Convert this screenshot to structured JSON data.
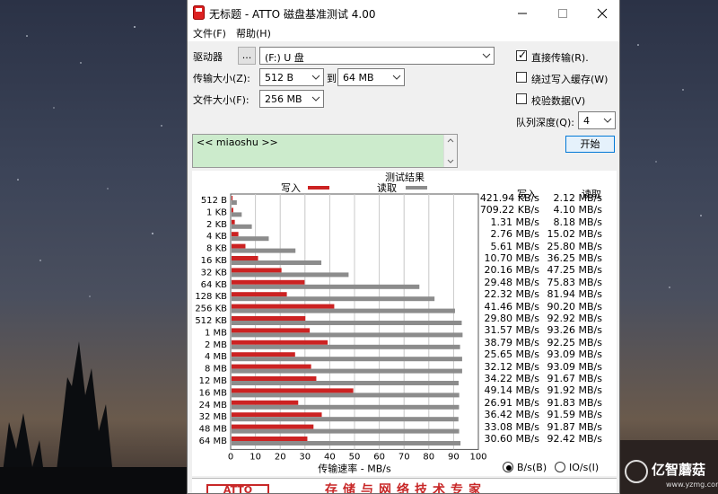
{
  "window": {
    "title": "无标题 - ATTO 磁盘基准测试 4.00"
  },
  "menu": {
    "file": "文件(F)",
    "help": "帮助(H)"
  },
  "controls": {
    "drive_label": "驱动器",
    "browse_label": "...",
    "drive_value": "(F:) U 盘",
    "transfer_size_label": "传输大小(Z):",
    "transfer_from": "512 B",
    "to_label": "到",
    "transfer_to": "64 MB",
    "file_size_label": "文件大小(F):",
    "file_size": "256 MB",
    "direct_io_label": "直接传输(R).",
    "direct_io_checked": true,
    "bypass_cache_label": "绕过写入缓存(W)",
    "bypass_cache_checked": false,
    "verify_label": "校验数据(V)",
    "verify_checked": false,
    "queue_depth_label": "队列深度(Q):",
    "queue_depth": "4",
    "start_label": "开始",
    "description": "<< miaoshu >>"
  },
  "results": {
    "title": "测试结果",
    "legend_write": "写入",
    "legend_read": "读取",
    "col_write": "写入",
    "col_read": "读取",
    "write_values": [
      "421.94 KB/s",
      "709.22 KB/s",
      "1.31 MB/s",
      "2.76 MB/s",
      "5.61 MB/s",
      "10.70 MB/s",
      "20.16 MB/s",
      "29.48 MB/s",
      "22.32 MB/s",
      "41.46 MB/s",
      "29.80 MB/s",
      "31.57 MB/s",
      "38.79 MB/s",
      "25.65 MB/s",
      "32.12 MB/s",
      "34.22 MB/s",
      "49.14 MB/s",
      "26.91 MB/s",
      "36.42 MB/s",
      "33.08 MB/s",
      "30.60 MB/s"
    ],
    "read_values": [
      "2.12 MB/s",
      "4.10 MB/s",
      "8.18 MB/s",
      "15.02 MB/s",
      "25.80 MB/s",
      "36.25 MB/s",
      "47.25 MB/s",
      "75.83 MB/s",
      "81.94 MB/s",
      "90.20 MB/s",
      "92.92 MB/s",
      "93.26 MB/s",
      "92.25 MB/s",
      "93.09 MB/s",
      "93.09 MB/s",
      "91.67 MB/s",
      "91.92 MB/s",
      "91.83 MB/s",
      "91.59 MB/s",
      "91.87 MB/s",
      "92.42 MB/s"
    ],
    "unit_bs": "B/s(B)",
    "unit_io": "IO/s(I)",
    "unit_selected": "bs"
  },
  "chart_data": {
    "type": "bar",
    "orientation": "horizontal",
    "categories": [
      "512 B",
      "1 KB",
      "2 KB",
      "4 KB",
      "8 KB",
      "16 KB",
      "32 KB",
      "64 KB",
      "128 KB",
      "256 KB",
      "512 KB",
      "1 MB",
      "2 MB",
      "4 MB",
      "8 MB",
      "12 MB",
      "16 MB",
      "24 MB",
      "32 MB",
      "48 MB",
      "64 MB"
    ],
    "series": [
      {
        "name": "写入",
        "color": "#cc2222",
        "values": [
          0.41,
          0.69,
          1.31,
          2.76,
          5.61,
          10.7,
          20.16,
          29.48,
          22.32,
          41.46,
          29.8,
          31.57,
          38.79,
          25.65,
          32.12,
          34.22,
          49.14,
          26.91,
          36.42,
          33.08,
          30.6
        ]
      },
      {
        "name": "读取",
        "color": "#8c8c8c",
        "values": [
          2.12,
          4.1,
          8.18,
          15.02,
          25.8,
          36.25,
          47.25,
          75.83,
          81.94,
          90.2,
          92.92,
          93.26,
          92.25,
          93.09,
          93.09,
          91.67,
          91.92,
          91.83,
          91.59,
          91.87,
          92.42
        ]
      }
    ],
    "xlabel": "传输速率 - MB/s",
    "xlim": [
      0,
      100
    ],
    "xticks": [
      "0",
      "10",
      "20",
      "30",
      "40",
      "50",
      "60",
      "70",
      "80",
      "90",
      "100"
    ],
    "grid": true
  },
  "banner": {
    "logo": "ATTO",
    "slogan": "存储与网络技术专家"
  },
  "watermark": {
    "text": "亿智蘑菇",
    "url": "www.yzmg.com"
  }
}
